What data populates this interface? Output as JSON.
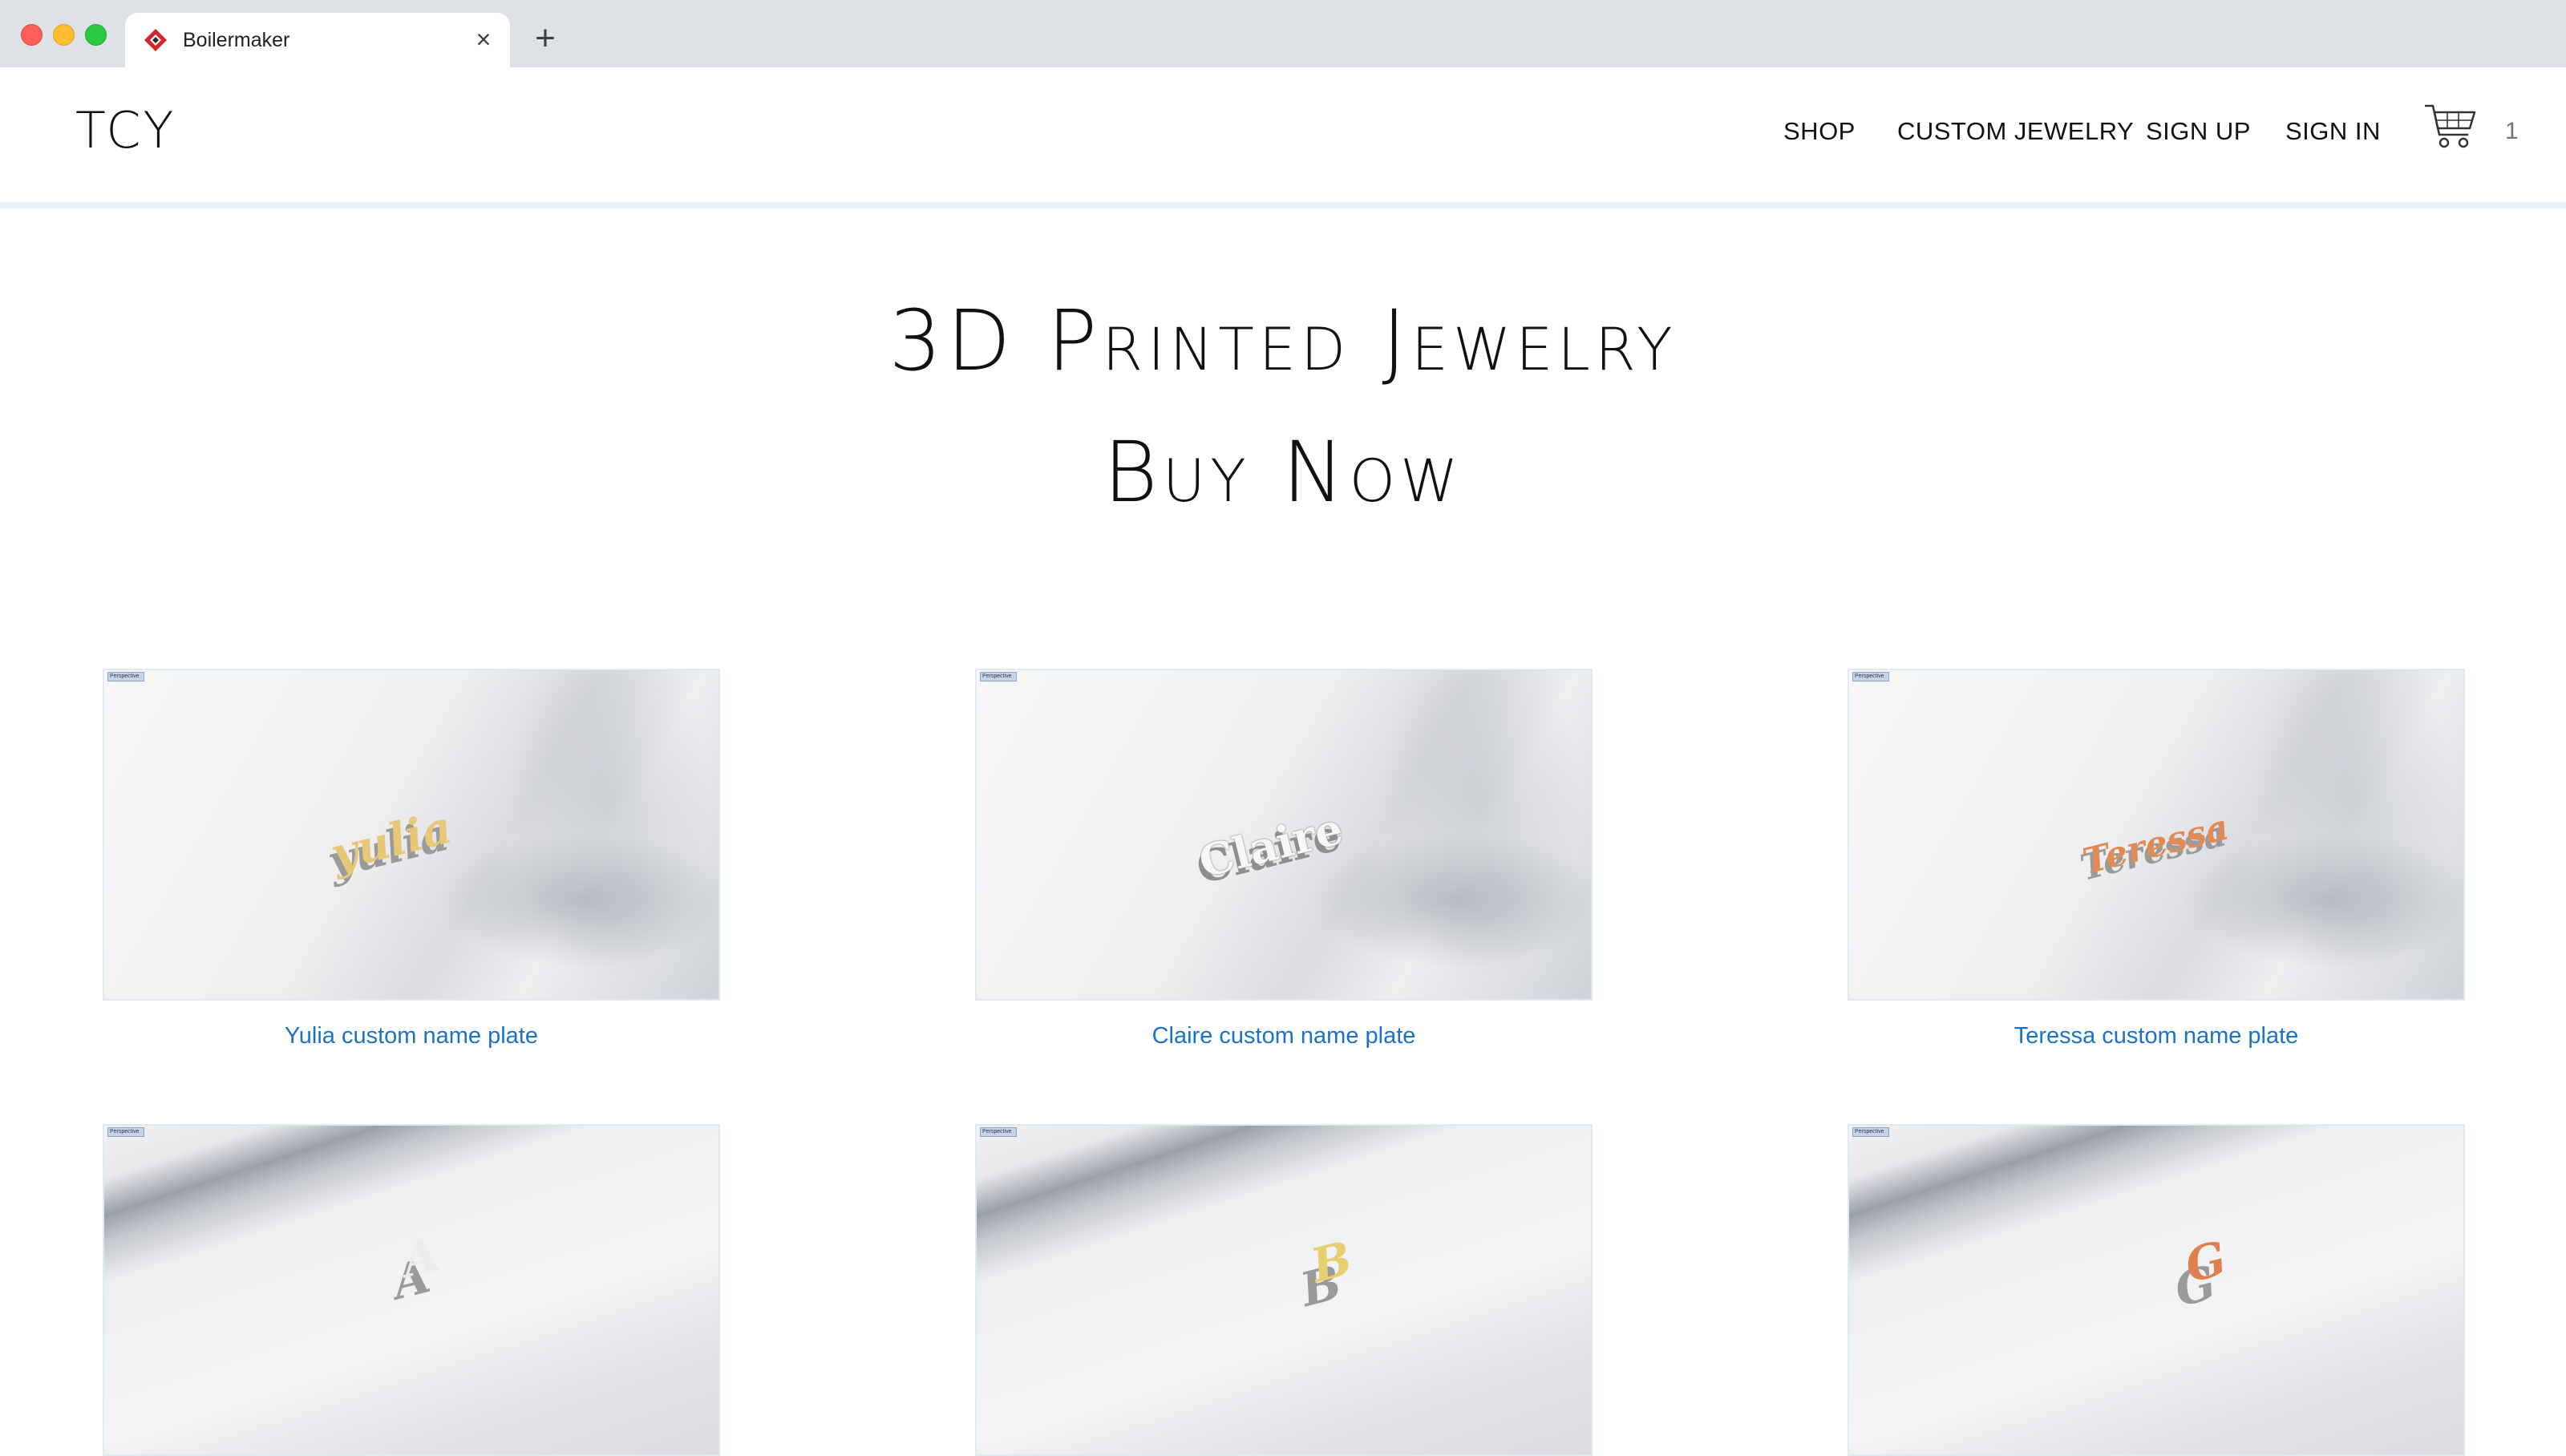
{
  "browser": {
    "tab_title": "Boilermaker",
    "tab_close": "×",
    "new_tab": "+"
  },
  "header": {
    "logo": "TCY",
    "nav": [
      "SHOP",
      "CUSTOM JEWELRY",
      "SIGN UP",
      "SIGN IN"
    ],
    "cart_count": "1"
  },
  "hero": {
    "title": "3D Printed Jewelry",
    "subtitle": "Buy Now"
  },
  "products": [
    {
      "caption": "Yulia custom name plate",
      "plate_text": "yulia",
      "color": "#e6c878"
    },
    {
      "caption": "Claire custom name plate",
      "plate_text": "Claire",
      "color": "#f4f4f4"
    },
    {
      "caption": "Teressa custom name plate",
      "plate_text": "Teressa",
      "color": "#e08a56"
    },
    {
      "caption": "",
      "plate_text": "A",
      "color": "#ececec"
    },
    {
      "caption": "",
      "plate_text": "B",
      "color": "#e6cf6e"
    },
    {
      "caption": "",
      "plate_text": "G",
      "color": "#e07f4e"
    }
  ],
  "viewport_label": "Perspective"
}
